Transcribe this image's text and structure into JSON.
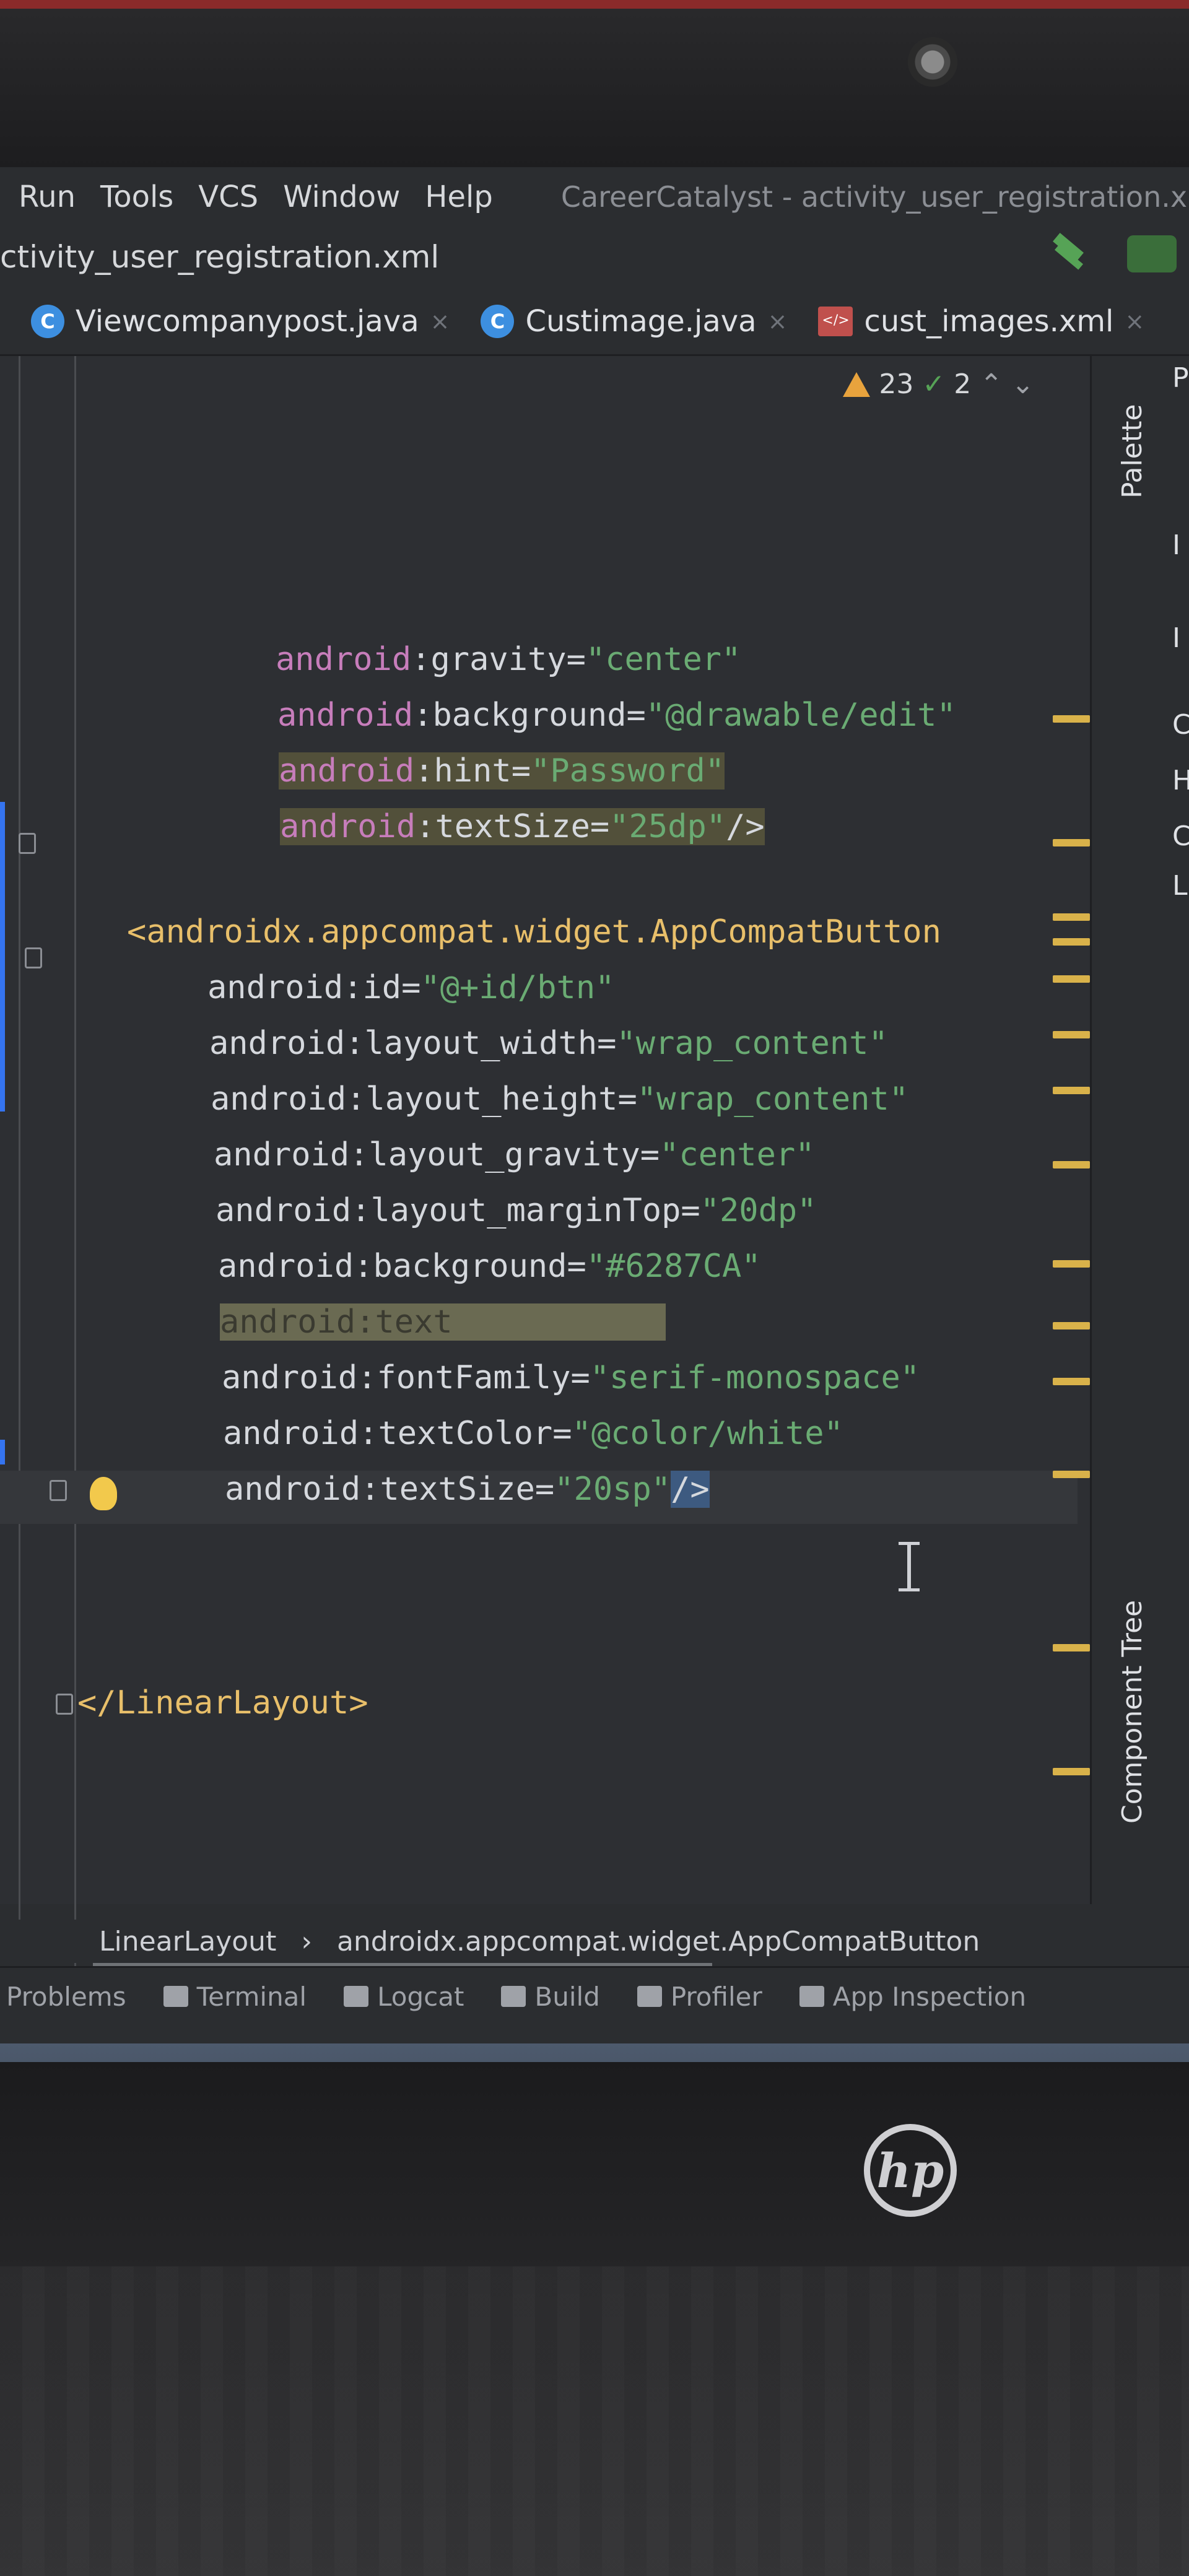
{
  "menu": {
    "items": [
      "Run",
      "Tools",
      "VCS",
      "Window",
      "Help"
    ],
    "window_title": "CareerCatalyst - activity_user_registration.xm"
  },
  "path": {
    "file": "ctivity_user_registration.xml"
  },
  "tabs": [
    {
      "label": "Viewcompanypost.java",
      "icon": "java-class-icon"
    },
    {
      "label": "Custimage.java",
      "icon": "java-class-icon"
    },
    {
      "label": "cust_images.xml",
      "icon": "xml-file-icon"
    }
  ],
  "inspections": {
    "warnings": "23",
    "weak_warnings": "2"
  },
  "code": {
    "l1": {
      "ns": "android",
      "attr": "gravity",
      "val": "\"center\""
    },
    "l2": {
      "ns": "android",
      "attr": "background",
      "val": "\"@drawable/edit\""
    },
    "l3": {
      "ns": "android",
      "attr": "hint",
      "val": "\"Password\""
    },
    "l4": {
      "ns": "android",
      "attr": "textSize",
      "val": "\"25dp\"",
      "end": "/>"
    },
    "l5": {
      "open": "<",
      "tag": "androidx.appcompat.widget.AppCompatButton"
    },
    "l6": {
      "ns": "android",
      "attr": "id",
      "val": "\"@+id/btn\""
    },
    "l7": {
      "ns": "android",
      "attr": "layout_width",
      "val": "\"wrap_content\""
    },
    "l8": {
      "ns": "android",
      "attr": "layout_height",
      "val": "\"wrap_content\""
    },
    "l9": {
      "ns": "android",
      "attr": "layout_gravity",
      "val": "\"center\""
    },
    "l10": {
      "ns": "android",
      "attr": "layout_marginTop",
      "val": "\"20dp\""
    },
    "l11": {
      "ns": "android",
      "attr": "background",
      "val": "\"#6287CA\""
    },
    "l12": {
      "ns": "android",
      "attr": "text"
    },
    "l13": {
      "ns": "android",
      "attr": "fontFamily",
      "val": "\"serif-monospace\""
    },
    "l14": {
      "ns": "android",
      "attr": "textColor",
      "val": "\"@color/white\""
    },
    "l15": {
      "ns": "android",
      "attr": "textSize",
      "val": "\"20sp\"",
      "end": "/>"
    },
    "l16": {
      "tag": "</LinearLayout>"
    }
  },
  "right_panel": {
    "palette": "Palette",
    "component_tree": "Component Tree",
    "letters": [
      "P",
      "I",
      "I",
      "C",
      "H",
      "C",
      "L"
    ]
  },
  "breadcrumb": {
    "root": "LinearLayout",
    "leaf": "androidx.appcompat.widget.AppCompatButton"
  },
  "tool_windows": [
    "Problems",
    "Terminal",
    "Logcat",
    "Build",
    "Profiler",
    "App Inspection"
  ],
  "brand": {
    "logo": "hp"
  },
  "colors": {
    "accent": "#3574f0",
    "tag": "#e8bf6a",
    "value": "#6aab73",
    "namespace": "#c77dbb"
  }
}
